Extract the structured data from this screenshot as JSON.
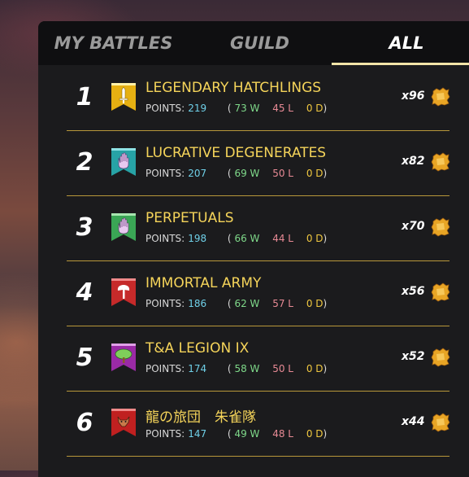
{
  "tabs": [
    {
      "label": "MY BATTLES",
      "active": false
    },
    {
      "label": "GUILD",
      "active": false
    },
    {
      "label": "ALL",
      "active": true
    }
  ],
  "stats_label": "POINTS:",
  "rows": [
    {
      "rank": "1",
      "name": "LEGENDARY HATCHLINGS",
      "points": "219",
      "wins": "73 W",
      "losses": "45 L",
      "draws": "0 D",
      "multiplier": "x96",
      "banner_icon": "sword-icon",
      "banner_color": "#e6b012"
    },
    {
      "rank": "2",
      "name": "LUCRATIVE DEGENERATES",
      "points": "207",
      "wins": "69 W",
      "losses": "50 L",
      "draws": "0 D",
      "multiplier": "x82",
      "banner_icon": "hand-icon",
      "banner_color": "#27a3a6"
    },
    {
      "rank": "3",
      "name": "PERPETUALS",
      "points": "198",
      "wins": "66 W",
      "losses": "44 L",
      "draws": "0 D",
      "multiplier": "x70",
      "banner_icon": "hand-icon",
      "banner_color": "#3aa655"
    },
    {
      "rank": "4",
      "name": "IMMORTAL ARMY",
      "points": "186",
      "wins": "62 W",
      "losses": "57 L",
      "draws": "0 D",
      "multiplier": "x56",
      "banner_icon": "axe-icon",
      "banner_color": "#c62a2a"
    },
    {
      "rank": "5",
      "name": "T&A LEGION IX",
      "points": "174",
      "wins": "58 W",
      "losses": "50 L",
      "draws": "0 D",
      "multiplier": "x52",
      "banner_icon": "tree-icon",
      "banner_color": "#9a2aa6"
    },
    {
      "rank": "6",
      "name": "龍の旅団　朱雀隊",
      "points": "147",
      "wins": "49 W",
      "losses": "48 L",
      "draws": "0 D",
      "multiplier": "x44",
      "banner_icon": "wolf-icon",
      "banner_color": "#c02020"
    }
  ]
}
